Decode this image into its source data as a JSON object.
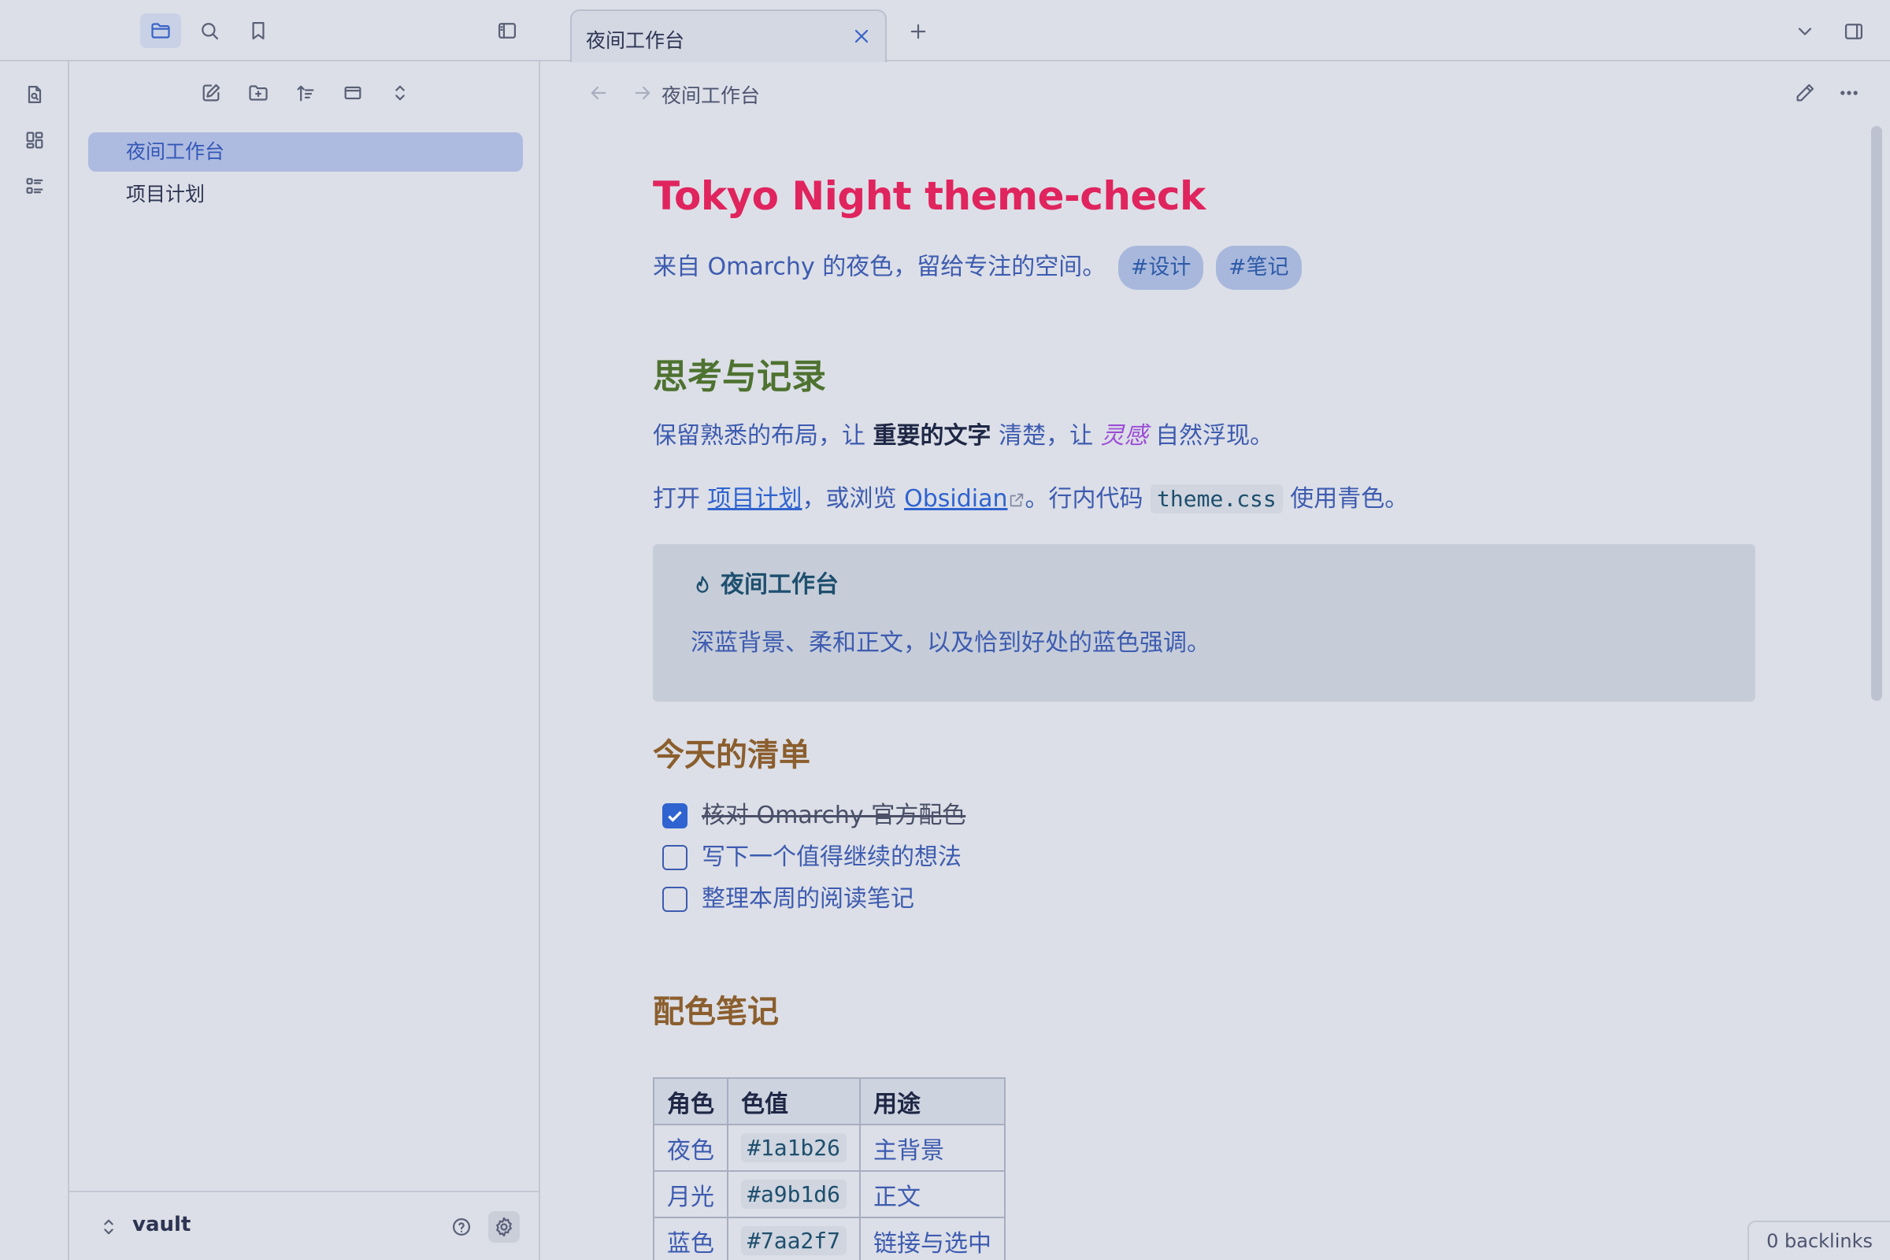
{
  "colors": {
    "accent": "#3a63c6",
    "title": "#e0245e",
    "h2": "#4e7230",
    "h3": "#8b5e2e",
    "text": "#3d5bb0"
  },
  "left_toolbar": {
    "icons": [
      "folder-icon",
      "search-icon",
      "bookmark-icon",
      "sidebar-toggle-icon"
    ]
  },
  "file_explorer": {
    "files": [
      {
        "label": "夜间工作台",
        "active": true
      },
      {
        "label": "项目计划",
        "active": false
      }
    ]
  },
  "vault": {
    "name": "vault"
  },
  "tab": {
    "title": "夜间工作台"
  },
  "breadcrumb": {
    "title": "夜间工作台"
  },
  "note": {
    "title": "Tokyo Night theme-check",
    "subtitle": "来自 Omarchy 的夜色，留给专注的空间。",
    "tags": [
      "#设计",
      "#笔记"
    ],
    "h2": "思考与记录",
    "p1_a": "保留熟悉的布局，让 ",
    "p1_strong": "重要的文字",
    "p1_b": " 清楚，让 ",
    "p1_em": "灵感",
    "p1_c": " 自然浮现。",
    "p2_a": "打开 ",
    "p2_link1": "项目计划",
    "p2_b": "，或浏览 ",
    "p2_link2": "Obsidian",
    "p2_c": "。行内代码 ",
    "p2_code": "theme.css",
    "p2_d": " 使用青色。",
    "callout_title": "夜间工作台",
    "callout_body": "深蓝背景、柔和正文，以及恰到好处的蓝色强调。",
    "h3_tasks": "今天的清单",
    "tasks": [
      {
        "text": "核对 Omarchy 官方配色",
        "done": true
      },
      {
        "text": "写下一个值得继续的想法",
        "done": false
      },
      {
        "text": "整理本周的阅读笔记",
        "done": false
      }
    ],
    "h3_colors": "配色笔记",
    "table": {
      "headers": [
        "角色",
        "色值",
        "用途"
      ],
      "rows": [
        [
          "夜色",
          "#1a1b26",
          "主背景"
        ],
        [
          "月光",
          "#a9b1d6",
          "正文"
        ],
        [
          "蓝色",
          "#7aa2f7",
          "链接与选中"
        ]
      ]
    }
  },
  "status": {
    "backlinks": "0 backlinks"
  }
}
